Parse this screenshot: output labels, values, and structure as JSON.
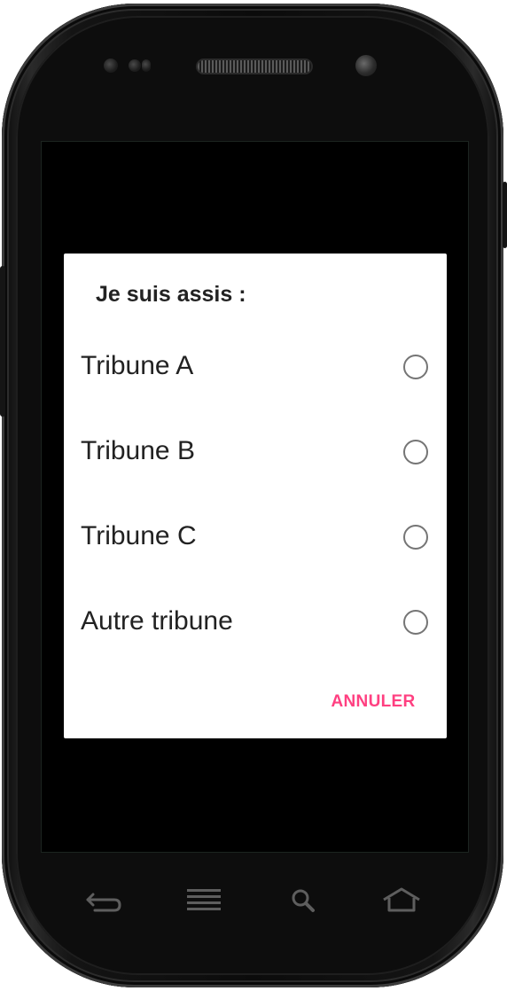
{
  "dialog": {
    "title": "Je suis assis :",
    "options": [
      {
        "label": "Tribune A",
        "selected": false
      },
      {
        "label": "Tribune B",
        "selected": false
      },
      {
        "label": "Tribune C",
        "selected": false
      },
      {
        "label": "Autre tribune",
        "selected": false
      }
    ],
    "cancel_label": "ANNULER"
  },
  "colors": {
    "accent": "#ff4081",
    "dialog_bg": "#ffffff",
    "screen_bg": "#000000",
    "radio_stroke": "#757575",
    "text": "#222222"
  },
  "hardware_keys": [
    {
      "icon": "back-icon"
    },
    {
      "icon": "menu-icon"
    },
    {
      "icon": "search-icon"
    },
    {
      "icon": "home-icon"
    }
  ]
}
